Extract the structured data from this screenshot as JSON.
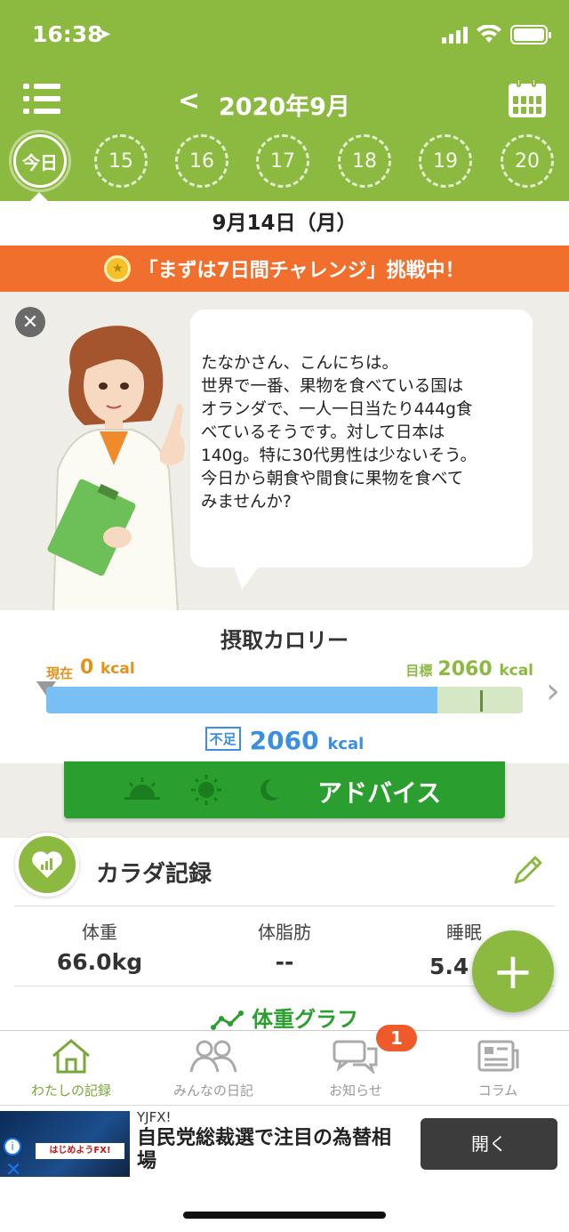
{
  "status_bar": {
    "time": "16:38",
    "location_icon": "location-arrow-icon"
  },
  "header": {
    "month_title": "2020年9月",
    "prev_icon": "chevron-left-icon",
    "menu_icon": "list-menu-icon",
    "calendar_icon": "calendar-icon",
    "days": [
      {
        "label": "今日",
        "today": true
      },
      {
        "label": "15"
      },
      {
        "label": "16"
      },
      {
        "label": "17"
      },
      {
        "label": "18"
      },
      {
        "label": "19"
      },
      {
        "label": "20"
      }
    ]
  },
  "date_bar": {
    "text": "9月14日（月）"
  },
  "challenge": {
    "text": "「まずは7日間チャレンジ」挑戦中！",
    "medal_icon": "medal-icon"
  },
  "advice": {
    "message": "たなかさん、こんにちは。\n世界で一番、果物を食べている国は\nオランダで、一人一日当たり444g食\nべているそうです。対して日本は\n140g。特に30代男性は少ないそう。\n今日から朝食や間食に果物を食べて\nみませんか?",
    "close_icon": "close-icon"
  },
  "calories": {
    "title": "摂取カロリー",
    "current_label": "現在",
    "current_value": "0",
    "unit": "kcal",
    "goal_label": "目標",
    "goal_value": "2060",
    "deficit_label": "不足",
    "deficit_value": "2060",
    "fill_fraction": 0.82,
    "goal_fraction": 0.91,
    "advice_button": "アドバイス",
    "meal_icons": [
      "sunrise-icon",
      "sun-icon",
      "moon-icon"
    ]
  },
  "body_record": {
    "title": "カラダ記録",
    "metrics": [
      {
        "label": "体重",
        "value": "66.0kg"
      },
      {
        "label": "体脂肪",
        "value": "--"
      },
      {
        "label": "睡眠",
        "value": "5.4 時"
      }
    ],
    "graph_link": "体重グラフ"
  },
  "tabs": [
    {
      "label": "わたしの記録",
      "icon": "home-icon",
      "active": true
    },
    {
      "label": "みんなの日記",
      "icon": "people-icon"
    },
    {
      "label": "お知らせ",
      "icon": "chat-bubbles-icon"
    },
    {
      "label": "コラム",
      "icon": "newspaper-icon"
    }
  ],
  "notification_badge": "1",
  "ad": {
    "sponsor": "YJFX!",
    "headline": "自民党総裁選で注目の為替相場",
    "button": "開く",
    "image_strip": "はじめようFX!"
  },
  "colors": {
    "brand_green": "#8cb93f",
    "challenge_orange": "#f06f2c",
    "advice_green": "#2a9f2f",
    "deficit_blue": "#3a8fe0"
  }
}
